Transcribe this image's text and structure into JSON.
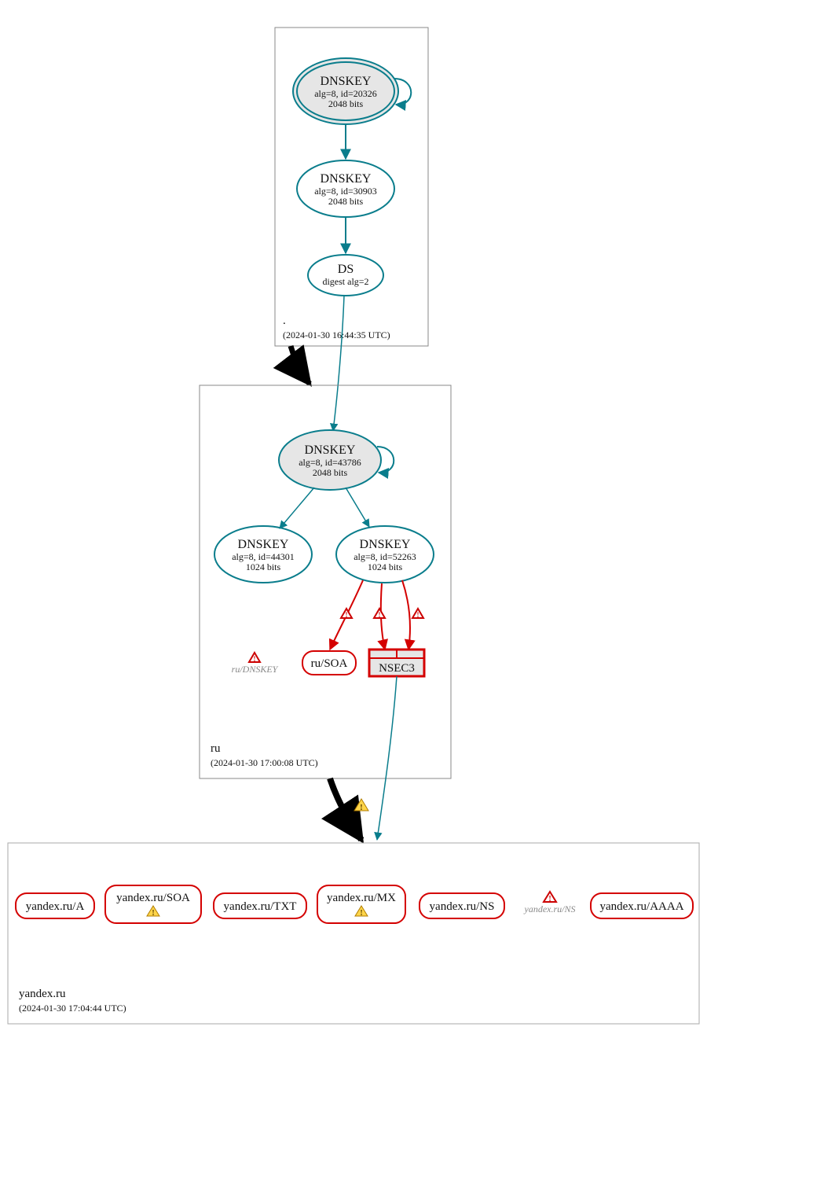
{
  "zones": {
    "root": {
      "label": ".",
      "timestamp": "(2024-01-30 16:44:35 UTC)"
    },
    "ru": {
      "label": "ru",
      "timestamp": "(2024-01-30 17:00:08 UTC)"
    },
    "yandex": {
      "label": "yandex.ru",
      "timestamp": "(2024-01-30 17:04:44 UTC)"
    }
  },
  "nodes": {
    "root_ksk": {
      "title": "DNSKEY",
      "l2": "alg=8, id=20326",
      "l3": "2048 bits"
    },
    "root_zsk": {
      "title": "DNSKEY",
      "l2": "alg=8, id=30903",
      "l3": "2048 bits"
    },
    "root_ds": {
      "title": "DS",
      "l2": "digest alg=2"
    },
    "ru_ksk": {
      "title": "DNSKEY",
      "l2": "alg=8, id=43786",
      "l3": "2048 bits"
    },
    "ru_zsk1": {
      "title": "DNSKEY",
      "l2": "alg=8, id=44301",
      "l3": "1024 bits"
    },
    "ru_zsk2": {
      "title": "DNSKEY",
      "l2": "alg=8, id=52263",
      "l3": "1024 bits"
    },
    "ru_dnskey_missing": {
      "label": "ru/DNSKEY"
    },
    "ru_soa": {
      "label": "ru/SOA"
    },
    "ru_nsec3": {
      "label": "NSEC3"
    },
    "y_a": {
      "label": "yandex.ru/A"
    },
    "y_soa": {
      "label": "yandex.ru/SOA"
    },
    "y_txt": {
      "label": "yandex.ru/TXT"
    },
    "y_mx": {
      "label": "yandex.ru/MX"
    },
    "y_ns": {
      "label": "yandex.ru/NS"
    },
    "y_ns_missing": {
      "label": "yandex.ru/NS"
    },
    "y_aaaa": {
      "label": "yandex.ru/AAAA"
    }
  }
}
